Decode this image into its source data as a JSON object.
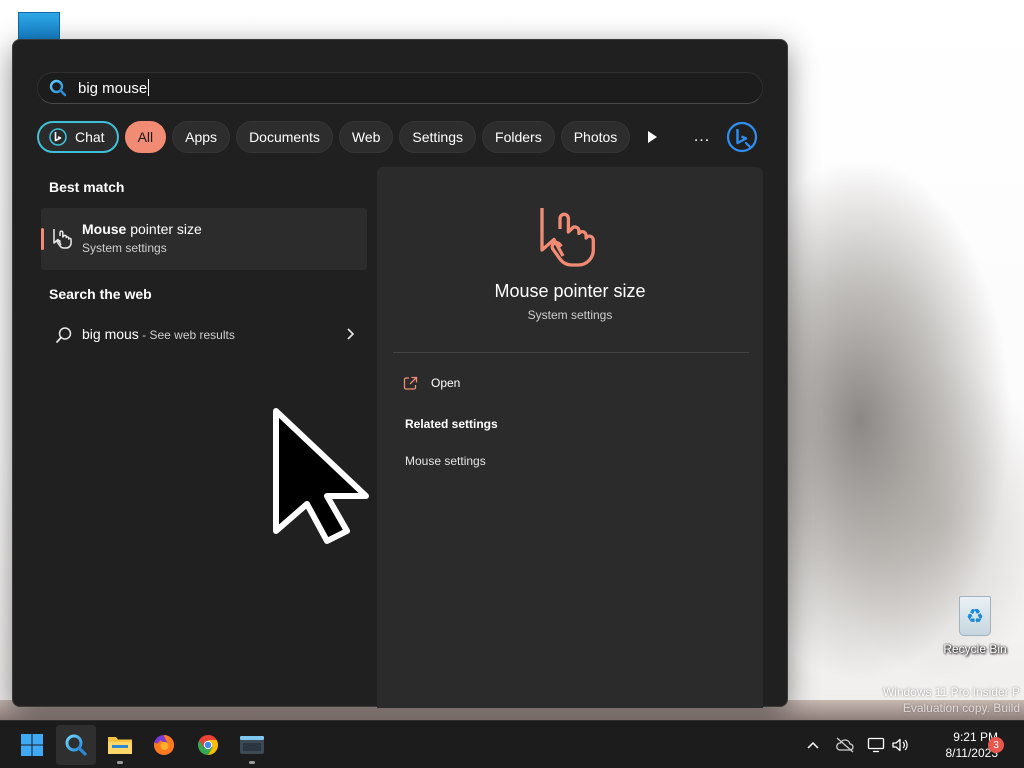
{
  "desktop": {
    "recycle_bin_label": "Recycle Bin",
    "watermark_line1": "Windows 11 Pro Insider P",
    "watermark_line2": "Evaluation copy. Build"
  },
  "search": {
    "query": "big mouse"
  },
  "filters": {
    "chat": "Chat",
    "all": "All",
    "apps": "Apps",
    "documents": "Documents",
    "web": "Web",
    "settings": "Settings",
    "folders": "Folders",
    "photos": "Photos",
    "more": "..."
  },
  "results": {
    "best_match_header": "Best match",
    "best_match": {
      "title_bold": "Mouse",
      "title_rest": " pointer size",
      "subtitle": "System settings"
    },
    "search_web_header": "Search the web",
    "web_result": {
      "query": "big mous",
      "suffix": " - See web results"
    }
  },
  "details": {
    "title": "Mouse pointer size",
    "subtitle": "System settings",
    "open_label": "Open",
    "related_header": "Related settings",
    "related_items": [
      "Mouse settings"
    ]
  },
  "taskbar": {
    "time": "9:21 PM",
    "date": "8/11/2023",
    "notification_count": "3"
  },
  "colors": {
    "accent": "#f28b74",
    "panel_bg": "#202020",
    "pane_bg": "#2b2b2b",
    "chat_border": "#3ec0d6",
    "taskbar_bg": "#1c1c1c"
  }
}
